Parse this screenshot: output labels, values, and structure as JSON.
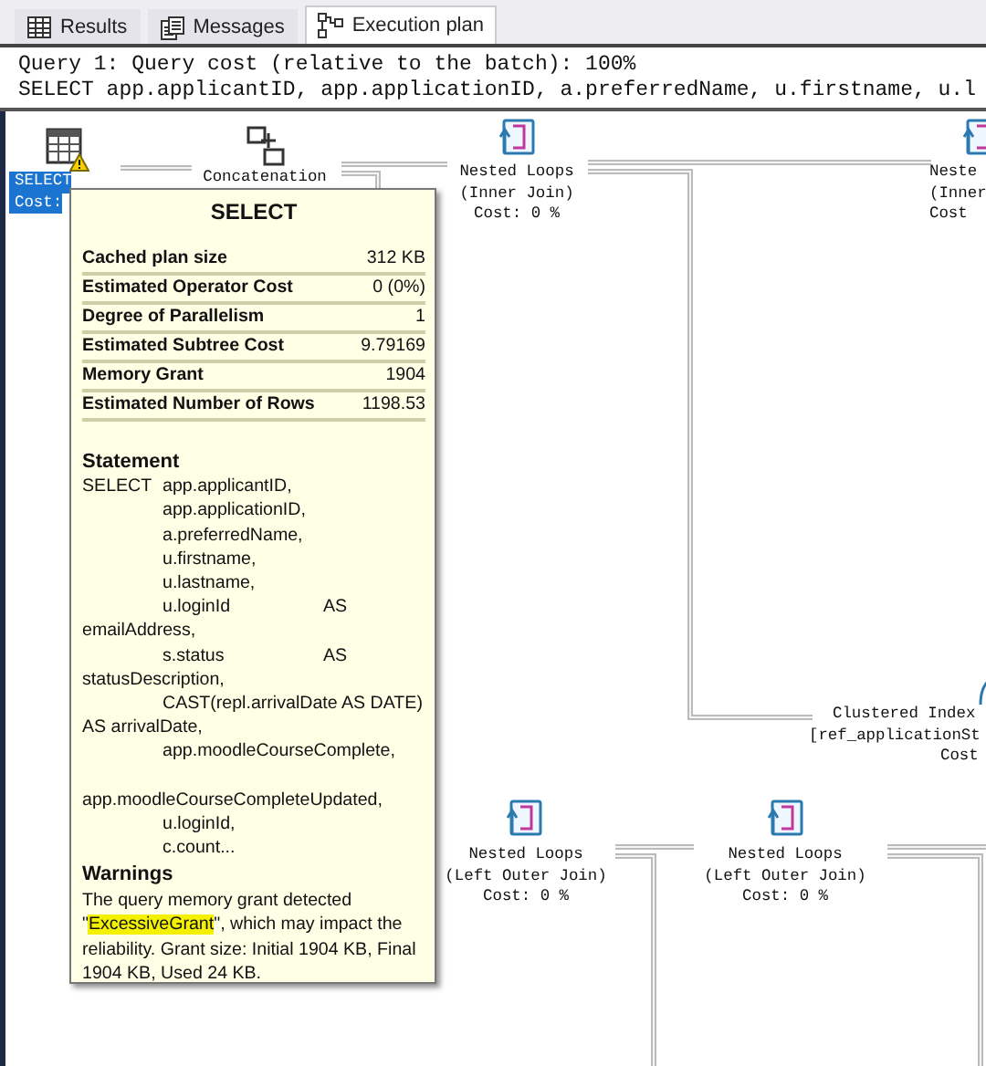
{
  "tabs": [
    {
      "label": "Results",
      "kind": "grid",
      "selected": false
    },
    {
      "label": "Messages",
      "kind": "messages",
      "selected": false
    },
    {
      "label": "Execution plan",
      "kind": "plan",
      "selected": true
    }
  ],
  "query_header": [
    "Query 1: Query cost (relative to the batch): 100%",
    "SELECT app.applicantID, app.applicationID, a.preferredName, u.firstname, u.l"
  ],
  "plan_nodes": [
    {
      "kind": "select",
      "lines": [
        "SELECT",
        "Cost:"
      ],
      "selected": true,
      "warning": true
    },
    {
      "kind": "concatenation",
      "lines": [
        "Concatenation"
      ],
      "selected": false
    },
    {
      "kind": "nested-loops",
      "lines": [
        "Nested Loops",
        "(Inner Join)",
        "Cost: 0 %"
      ],
      "selected": false
    },
    {
      "kind": "nested-loops",
      "lines": [
        "Neste",
        "(Inner",
        "Cost"
      ],
      "selected": false
    },
    {
      "kind": "clustered-index",
      "lines": [
        "Clustered Index",
        "[ref_applicationSt",
        "Cost"
      ],
      "selected": false
    },
    {
      "kind": "nested-loops",
      "lines": [
        "Nested Loops",
        "(Left Outer Join)",
        "Cost: 0 %"
      ],
      "selected": false
    },
    {
      "kind": "nested-loops",
      "lines": [
        "Nested Loops",
        "(Left Outer Join)",
        "Cost: 0 %"
      ],
      "selected": false
    }
  ],
  "tooltip": {
    "title": "SELECT",
    "properties": [
      {
        "name": "Cached plan size",
        "value": "312 KB"
      },
      {
        "name": "Estimated Operator Cost",
        "value": "0 (0%)"
      },
      {
        "name": "Degree of Parallelism",
        "value": "1"
      },
      {
        "name": "Estimated Subtree Cost",
        "value": "9.79169"
      },
      {
        "name": "Memory Grant",
        "value": "1904"
      },
      {
        "name": "Estimated Number of Rows",
        "value": "1198.53"
      }
    ],
    "statement_heading": "Statement",
    "statement": "SELECT\tapp.applicantID,\n\tapp.applicationID,\n\ta.preferredName,\n\tu.firstname,\n\tu.lastname,\n\tu.loginId\t\tAS\nemailAddress,\n\ts.status\t\tAS\nstatusDescription,\n\tCAST(repl.arrivalDate AS DATE)\nAS arrivalDate,\n\tapp.moodleCourseComplete,\n\napp.moodleCourseCompleteUpdated,\n\tu.loginId,\n\tc.count...",
    "warnings_heading": "Warnings",
    "warning": {
      "before": "The query memory grant detected \"",
      "highlight": "ExcessiveGrant",
      "after": "\", which may impact the reliability. Grant size: Initial 1904 KB, Final 1904 KB, Used 24 KB."
    }
  }
}
